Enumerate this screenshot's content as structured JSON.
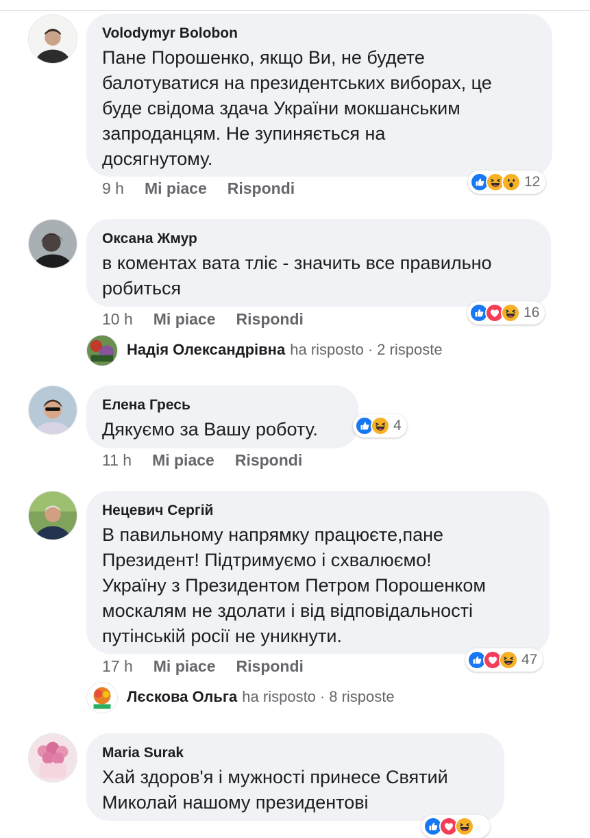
{
  "comments": [
    {
      "author": "Volodymyr Bolobon",
      "text": "Пане Порошенко, якщо Ви, не будете\nбалотуватися на президентських виборах, це\nбуде свідома здача України мокшанським\nзапроданцям. Не зупиняється на\nдосягнутому.",
      "time": "9 h",
      "like": "Mi piace",
      "reply": "Rispondi",
      "reactions": [
        "like-icon",
        "haha-icon",
        "wow-icon"
      ],
      "reaction_count": "12"
    },
    {
      "author": "Оксана Жмур",
      "text": "в коментах вата тліє - значить все правильно\nробиться",
      "time": "10 h",
      "like": "Mi piace",
      "reply": "Rispondi",
      "reactions": [
        "like-icon",
        "love-icon",
        "haha-icon"
      ],
      "reaction_count": "16",
      "reply_summary": {
        "name": "Надія Олександрівна",
        "action": "ha risposto",
        "sep": "·",
        "count": "2 risposte"
      }
    },
    {
      "author": "Елена Гресь",
      "text": "Дякуємо за Вашу роботу.",
      "time": "11 h",
      "like": "Mi piace",
      "reply": "Rispondi",
      "reactions": [
        "like-icon",
        "haha-icon"
      ],
      "reaction_count": "4"
    },
    {
      "author": "Нецевич Сергій",
      "text": "В павильному напрямку працюєте,пане\nПрезидент! Підтримуємо і схвалюємо!\nУкраїну з Президентом Петром Порошенком\nмоскалям не здолати і від відповідальності\nпутінській росії не уникнути.",
      "time": "17 h",
      "like": "Mi piace",
      "reply": "Rispondi",
      "reactions": [
        "like-icon",
        "love-icon",
        "haha-icon"
      ],
      "reaction_count": "47",
      "reply_summary": {
        "name": "Лєскова Ольга",
        "action": "ha risposto",
        "sep": "·",
        "count": "8 risposte"
      }
    },
    {
      "author": "Maria Surak",
      "text": "Хай здоров'я і мужності принесе Святий\nМиколай нашому президентові"
    }
  ],
  "colors": {
    "bubble": "#f0f2f5",
    "like": "#1877f2",
    "love": "#f33e58",
    "haha": "#f7b125",
    "meta_text": "#65676b"
  }
}
